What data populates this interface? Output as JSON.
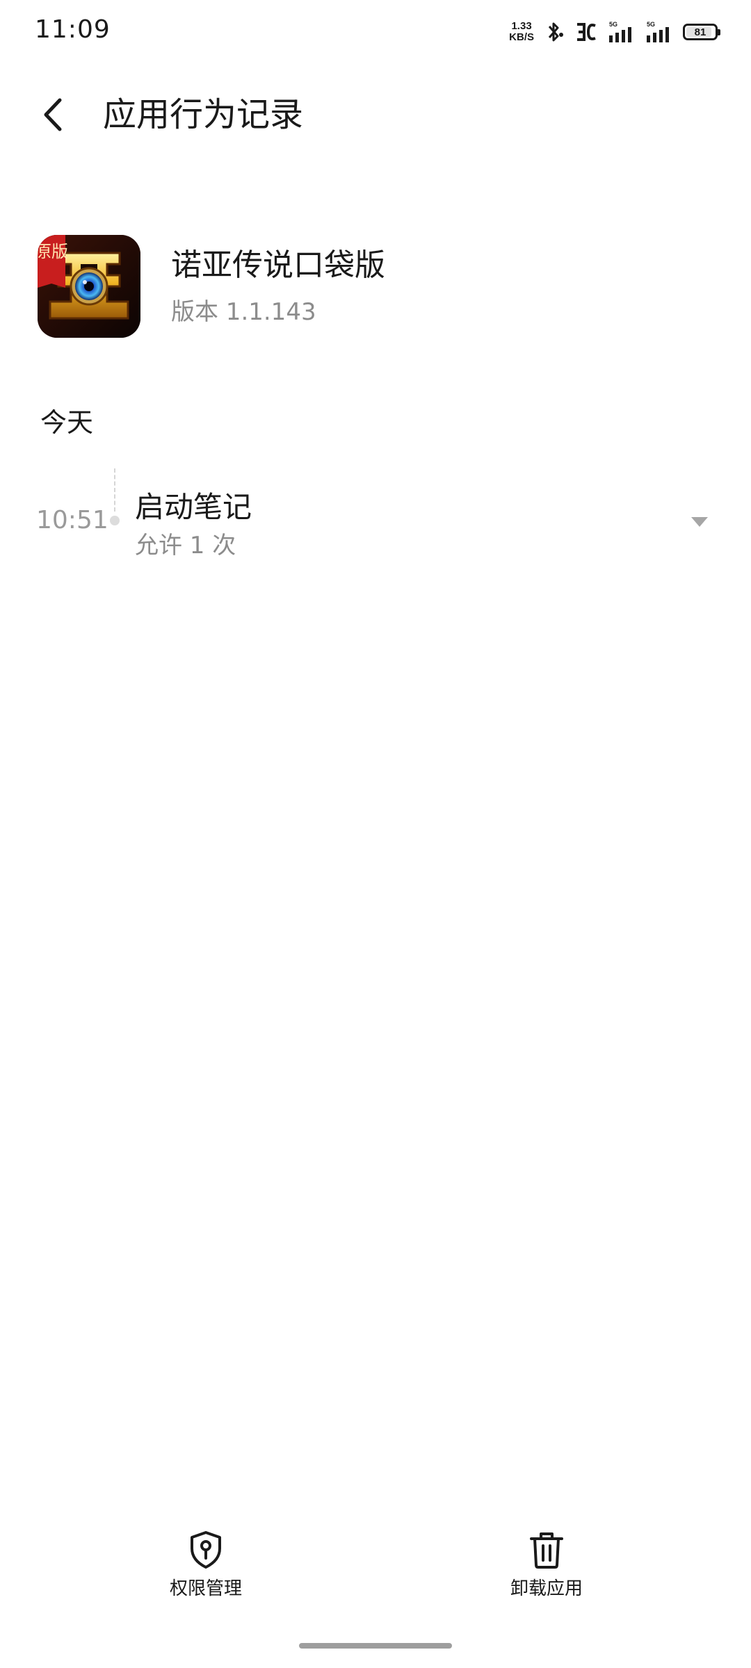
{
  "status_bar": {
    "time": "11:09",
    "net_speed_value": "1.33",
    "net_speed_unit": "KB/S",
    "battery_level": "81",
    "icons": [
      "bluetooth-icon",
      "hd-voice-icon",
      "signal-5g-icon",
      "signal-5g-icon"
    ]
  },
  "header": {
    "title": "应用行为记录",
    "back_icon": "chevron-left-icon"
  },
  "app": {
    "name": "诺亚传说口袋版",
    "version": "版本 1.1.143",
    "icon_badge": "原版"
  },
  "section": {
    "title": "今天"
  },
  "records": [
    {
      "time": "10:51",
      "title": "启动笔记",
      "detail": "允许 1 次",
      "expand_icon": "triangle-down-icon"
    }
  ],
  "bottom_bar": {
    "permission_label": "权限管理",
    "uninstall_label": "卸载应用"
  },
  "colors": {
    "text_primary": "#1a1a1a",
    "text_secondary": "#8c8c8c",
    "timeline": "#d5d5d5",
    "background": "#ffffff"
  }
}
